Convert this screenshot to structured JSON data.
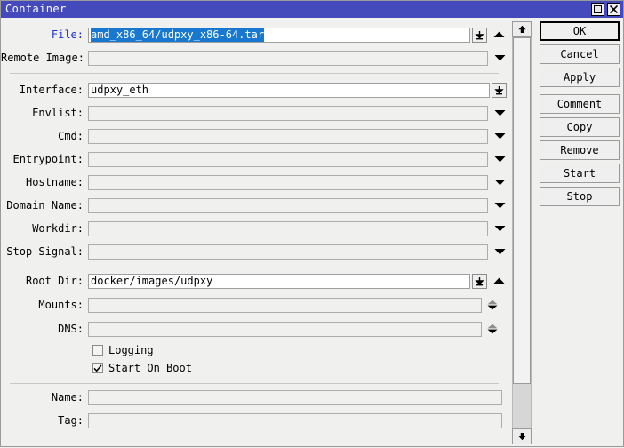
{
  "window": {
    "title": "Container",
    "controls": [
      {
        "name": "maximize-button",
        "icon": "maximize-icon"
      },
      {
        "name": "close-button",
        "icon": "close-icon"
      }
    ]
  },
  "form": {
    "fields": [
      {
        "label": "File:",
        "value": "amd_x86_64/udpxy_x86-64.tar",
        "selected": true,
        "highlight_label": true,
        "enabled": true,
        "browse": true,
        "arrow": "up"
      },
      {
        "label": "Remote Image:",
        "value": "",
        "selected": false,
        "highlight_label": false,
        "enabled": false,
        "browse": false,
        "arrow": "down"
      },
      {
        "label": "Interface:",
        "value": "udpxy_eth",
        "selected": false,
        "highlight_label": false,
        "enabled": true,
        "browse": true,
        "arrow": "none"
      },
      {
        "label": "Envlist:",
        "value": "",
        "selected": false,
        "highlight_label": false,
        "enabled": false,
        "browse": false,
        "arrow": "down"
      },
      {
        "label": "Cmd:",
        "value": "",
        "selected": false,
        "highlight_label": false,
        "enabled": false,
        "browse": false,
        "arrow": "down"
      },
      {
        "label": "Entrypoint:",
        "value": "",
        "selected": false,
        "highlight_label": false,
        "enabled": false,
        "browse": false,
        "arrow": "down"
      },
      {
        "label": "Hostname:",
        "value": "",
        "selected": false,
        "highlight_label": false,
        "enabled": false,
        "browse": false,
        "arrow": "down"
      },
      {
        "label": "Domain Name:",
        "value": "",
        "selected": false,
        "highlight_label": false,
        "enabled": false,
        "browse": false,
        "arrow": "down"
      },
      {
        "label": "Workdir:",
        "value": "",
        "selected": false,
        "highlight_label": false,
        "enabled": false,
        "browse": false,
        "arrow": "down"
      },
      {
        "label": "Stop Signal:",
        "value": "",
        "selected": false,
        "highlight_label": false,
        "enabled": false,
        "browse": false,
        "arrow": "down"
      },
      {
        "label": "Root Dir:",
        "value": "docker/images/udpxy",
        "selected": false,
        "highlight_label": false,
        "enabled": true,
        "browse": true,
        "arrow": "up"
      },
      {
        "label": "Mounts:",
        "value": "",
        "selected": false,
        "highlight_label": false,
        "enabled": false,
        "browse": false,
        "arrow": "spinner"
      },
      {
        "label": "DNS:",
        "value": "",
        "selected": false,
        "highlight_label": false,
        "enabled": false,
        "browse": false,
        "arrow": "spinner"
      }
    ],
    "checkboxes": [
      {
        "label": "Logging",
        "checked": false
      },
      {
        "label": "Start On Boot",
        "checked": true
      }
    ],
    "bottom_fields": [
      {
        "label": "Name:",
        "value": "",
        "enabled": false
      },
      {
        "label": "Tag:",
        "value": "",
        "enabled": false
      }
    ]
  },
  "buttons": [
    {
      "label": "OK",
      "primary": true,
      "gap": false
    },
    {
      "label": "Cancel",
      "primary": false,
      "gap": false
    },
    {
      "label": "Apply",
      "primary": false,
      "gap": false
    },
    {
      "label": "Comment",
      "primary": false,
      "gap": true
    },
    {
      "label": "Copy",
      "primary": false,
      "gap": false
    },
    {
      "label": "Remove",
      "primary": false,
      "gap": false
    },
    {
      "label": "Start",
      "primary": false,
      "gap": false
    },
    {
      "label": "Stop",
      "primary": false,
      "gap": false
    }
  ],
  "scrollbar": {
    "up_icon": "scroll-up-arrow-icon",
    "down_icon": "scroll-down-arrow-icon"
  },
  "colors": {
    "titlebar": "#4449bb",
    "selection": "#1878d0",
    "label_accent": "#2030d0",
    "window_bg": "#f0f0ef"
  }
}
